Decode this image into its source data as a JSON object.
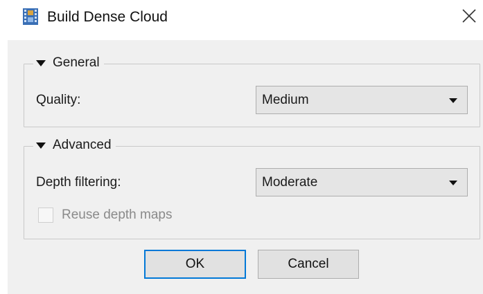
{
  "window": {
    "title": "Build Dense Cloud",
    "icon": "film-strip-icon",
    "close_icon": "close-icon"
  },
  "general": {
    "legend": "General",
    "quality_label": "Quality:",
    "quality_value": "Medium"
  },
  "advanced": {
    "legend": "Advanced",
    "depth_filtering_label": "Depth filtering:",
    "depth_filtering_value": "Moderate",
    "reuse_depth_maps_label": "Reuse depth maps",
    "reuse_depth_maps_checked": false,
    "reuse_depth_maps_enabled": false
  },
  "buttons": {
    "ok_label": "OK",
    "cancel_label": "Cancel"
  },
  "colors": {
    "focus_border": "#0078d7",
    "panel_background": "#f0f0f0",
    "icon_blue": "#3a6fb5"
  }
}
